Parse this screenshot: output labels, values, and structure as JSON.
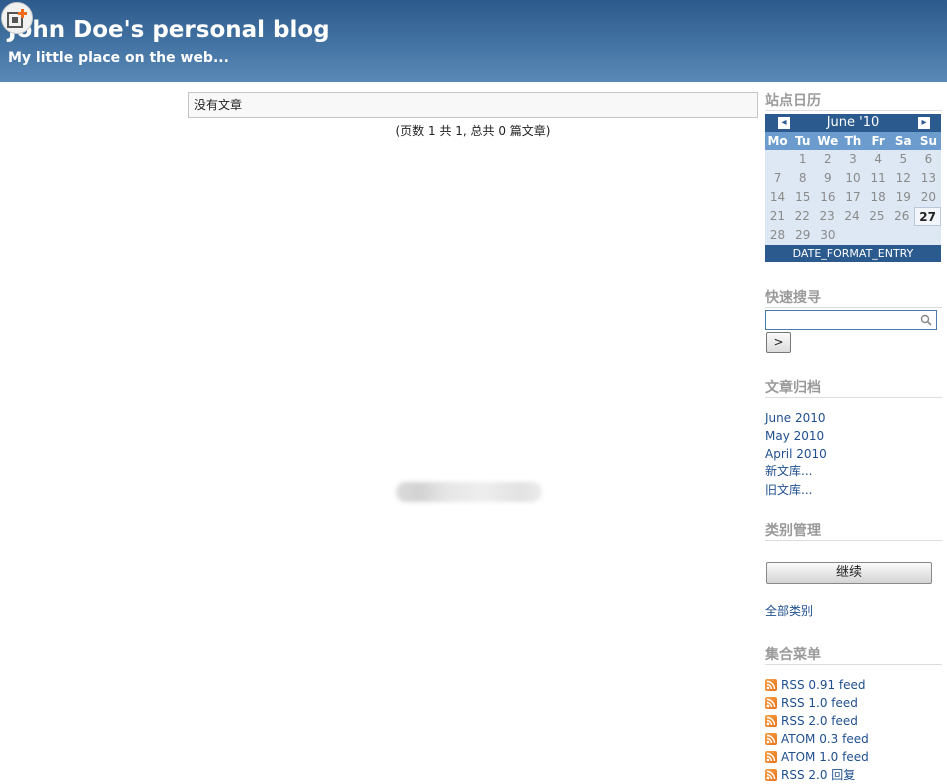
{
  "header": {
    "title": "John Doe's personal blog",
    "subtitle": "My little place on the web..."
  },
  "main": {
    "no_posts": "没有文章",
    "pagination": "(页数 1 共 1, 总共 0 篇文章)"
  },
  "sidebar": {
    "calendar": {
      "heading": "站点日历",
      "month_label": "June '10",
      "prev_label": "◂",
      "next_label": "▸",
      "weekdays": [
        "Mo",
        "Tu",
        "We",
        "Th",
        "Fr",
        "Sa",
        "Su"
      ],
      "weeks": [
        [
          "",
          "1",
          "2",
          "3",
          "4",
          "5",
          "6"
        ],
        [
          "7",
          "8",
          "9",
          "10",
          "11",
          "12",
          "13"
        ],
        [
          "14",
          "15",
          "16",
          "17",
          "18",
          "19",
          "20"
        ],
        [
          "21",
          "22",
          "23",
          "24",
          "25",
          "26",
          "27"
        ],
        [
          "28",
          "29",
          "30",
          "",
          "",
          "",
          ""
        ]
      ],
      "today": "27",
      "footer": "DATE_FORMAT_ENTRY"
    },
    "search": {
      "heading": "快速搜寻",
      "value": "",
      "go_label": ">"
    },
    "archives": {
      "heading": "文章归档",
      "links": [
        "June 2010",
        "May 2010",
        "April 2010",
        "新文库...",
        "旧文库..."
      ]
    },
    "categories": {
      "heading": "类别管理",
      "button_label": "继续",
      "all_link": "全部类别"
    },
    "feeds": {
      "heading": "集合菜单",
      "items": [
        "RSS 0.91 feed",
        "RSS 1.0 feed",
        "RSS 2.0 feed",
        "ATOM 0.3 feed",
        "ATOM 1.0 feed",
        "RSS 2.0 回复"
      ]
    }
  },
  "colors": {
    "header_top": "#2d5a8c",
    "header_bottom": "#5a89b6",
    "calendar_dark": "#2a5a8e",
    "calendar_mid": "#6b9ccd",
    "calendar_light": "#dde8f4",
    "link": "#1f4f8f",
    "heading_gray": "#9a9a9a",
    "rss_orange": "#e7721a"
  }
}
